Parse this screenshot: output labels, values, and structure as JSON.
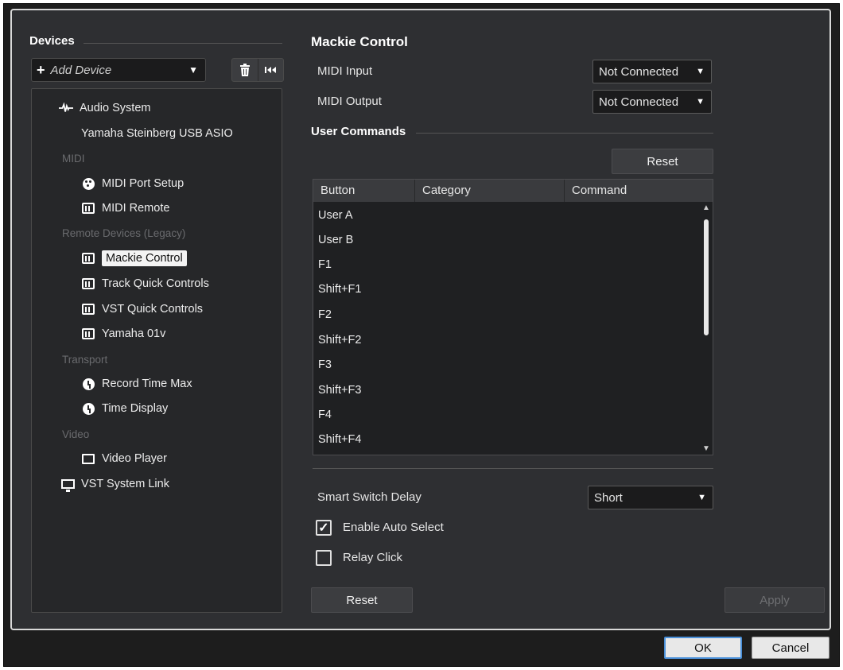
{
  "sidebar": {
    "title": "Devices",
    "add_device": "Add Device",
    "tree": [
      {
        "label": "Audio System",
        "icon": "audio-wave-icon"
      },
      {
        "label": "Yamaha Steinberg USB ASIO"
      },
      {
        "category": "MIDI"
      },
      {
        "label": "MIDI Port Setup",
        "icon": "midi-port-icon"
      },
      {
        "label": "MIDI Remote",
        "icon": "keyboard-icon"
      },
      {
        "category": "Remote Devices (Legacy)"
      },
      {
        "label": "Mackie Control",
        "icon": "keyboard-icon",
        "selected": true
      },
      {
        "label": "Track Quick Controls",
        "icon": "keyboard-icon"
      },
      {
        "label": "VST Quick Controls",
        "icon": "keyboard-icon"
      },
      {
        "label": "Yamaha 01v",
        "icon": "keyboard-icon"
      },
      {
        "category": "Transport"
      },
      {
        "label": "Record Time Max",
        "icon": "clock-icon"
      },
      {
        "label": "Time Display",
        "icon": "clock-icon"
      },
      {
        "category": "Video"
      },
      {
        "label": "Video Player",
        "icon": "video-icon"
      },
      {
        "label": "VST System Link",
        "icon": "monitor-icon"
      }
    ]
  },
  "main": {
    "title": "Mackie Control",
    "midi_input_label": "MIDI Input",
    "midi_input_value": "Not Connected",
    "midi_output_label": "MIDI Output",
    "midi_output_value": "Not Connected",
    "user_commands_title": "User Commands",
    "reset_label": "Reset",
    "table": {
      "columns": [
        "Button",
        "Category",
        "Command"
      ],
      "rows": [
        "User A",
        "User B",
        "F1",
        "Shift+F1",
        "F2",
        "Shift+F2",
        "F3",
        "Shift+F3",
        "F4",
        "Shift+F4"
      ]
    },
    "smart_switch_label": "Smart Switch Delay",
    "smart_switch_value": "Short",
    "enable_auto_select_label": "Enable Auto Select",
    "enable_auto_select_checked": true,
    "relay_click_label": "Relay Click",
    "relay_click_checked": false,
    "bottom_reset_label": "Reset",
    "apply_label": "Apply"
  },
  "footer": {
    "ok_label": "OK",
    "cancel_label": "Cancel"
  },
  "colors": {
    "panel_bg": "#2e2f32",
    "selected_bg": "#f3f3f3",
    "ok_border": "#4a90d9"
  }
}
